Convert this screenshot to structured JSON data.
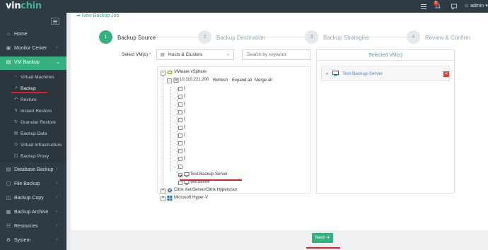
{
  "brand": {
    "logo_prefix": "vin",
    "logo_suffix": "chin"
  },
  "topbar": {
    "notification_count": "5",
    "user": "admin"
  },
  "sidebar": {
    "items": [
      {
        "label": "Home",
        "icon": "home-icon"
      },
      {
        "label": "Monitor Center",
        "icon": "monitor-icon"
      },
      {
        "label": "VM Backup",
        "icon": "vm-backup-icon"
      },
      {
        "label": "Database Backup",
        "icon": "database-icon"
      },
      {
        "label": "File Backup",
        "icon": "folder-icon"
      },
      {
        "label": "Backup Copy",
        "icon": "copy-icon"
      },
      {
        "label": "Backup Archive",
        "icon": "archive-icon"
      },
      {
        "label": "Resources",
        "icon": "resources-icon"
      },
      {
        "label": "System",
        "icon": "gear-icon"
      }
    ],
    "vm_sub_items": [
      {
        "label": "Virtual Machines"
      },
      {
        "label": "Backup"
      },
      {
        "label": "Restore"
      },
      {
        "label": "Instant Restore"
      },
      {
        "label": "Granular Restore"
      },
      {
        "label": "Backup Data"
      },
      {
        "label": "Virtual Infrastructure"
      },
      {
        "label": "Backup Proxy"
      }
    ]
  },
  "page": {
    "title": "New Backup Job"
  },
  "steps": [
    {
      "num": "1",
      "label": "Backup Source"
    },
    {
      "num": "2",
      "label": "Backup Destination"
    },
    {
      "num": "3",
      "label": "Backup Strategies"
    },
    {
      "num": "4",
      "label": "Review & Confirm"
    }
  ],
  "form": {
    "select_label": "Select VM(s)",
    "required_mark": "*",
    "view_dropdown": "Hosts & Clusters",
    "search_placeholder": "Search by keyword"
  },
  "tree": {
    "root": "VMware vSphere",
    "host": "10.110.221.200",
    "actions": {
      "refresh": "Refresh",
      "expand_all": "Expand all",
      "merge_all": "Merge all"
    },
    "blank_vm_marker": "(",
    "selected_vm": "Test-Backup-Server",
    "other_vm": "WinServer",
    "platforms": [
      "Citrix XenServer/Citrix Hypervisor",
      "Microsoft Hyper-V"
    ]
  },
  "selected_panel": {
    "title": "Selected VM(s)",
    "items": [
      "Test-Backup-Server"
    ]
  },
  "footer": {
    "next_label": "Next"
  },
  "colors": {
    "accent": "#35b07f",
    "sidebar": "#2f3b44",
    "topbar": "#2e3a44",
    "highlight": "#d6232d"
  }
}
